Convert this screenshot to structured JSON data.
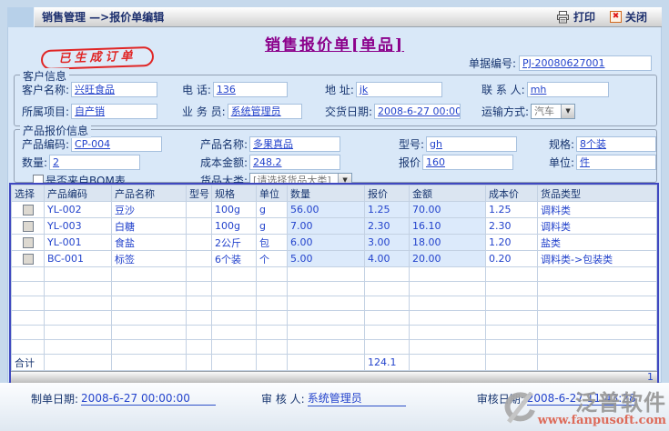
{
  "titlebar": {
    "breadcrumb": "销售管理 —>报价单编辑",
    "print_label": "打印",
    "close_label": "关闭"
  },
  "header": {
    "title": "销售报价单[单品]",
    "stamp": "已生成订单",
    "doc_no_label": "单据编号:",
    "doc_no": "PJ-20080627001"
  },
  "customer": {
    "legend": "客户信息",
    "rows": [
      [
        {
          "label": "客户名称:",
          "value": "兴旺食品"
        },
        {
          "label": "电 话:",
          "value": "136"
        },
        {
          "label": "地 址:",
          "value": "jk"
        },
        {
          "label": "联 系 人:",
          "value": "mh"
        }
      ],
      [
        {
          "label": "所属项目:",
          "value": "自产销"
        },
        {
          "label": "业 务 员:",
          "value": "系统管理员"
        },
        {
          "label": "交货日期:",
          "value": "2008-6-27 00:00"
        },
        {
          "label": "运输方式:",
          "value": "汽车"
        }
      ]
    ]
  },
  "product": {
    "legend": "产品报价信息",
    "rows": [
      [
        {
          "label": "产品编码:",
          "value": "CP-004"
        },
        {
          "label": "产品名称:",
          "value": "多果真品"
        },
        {
          "label": "型号:",
          "value": "gh"
        },
        {
          "label": "规格:",
          "value": "8个装"
        }
      ],
      [
        {
          "label": "数量:",
          "value": "2"
        },
        {
          "label": "成本金额:",
          "value": "248.2"
        },
        {
          "label": "报价",
          "value": "160"
        },
        {
          "label": "单位:",
          "value": "件"
        }
      ]
    ],
    "bom_label": "是否来自BOM表",
    "category_label": "货品大类:",
    "category_value": "[请选择货品大类]"
  },
  "table": {
    "columns": [
      "选择",
      "产品编码",
      "产品名称",
      "型号",
      "规格",
      "单位",
      "数量",
      "报价",
      "金额",
      "成本价",
      "货品类型"
    ],
    "rows": [
      {
        "code": "YL-002",
        "name": "豆沙",
        "model": "",
        "spec": "100g",
        "unit": "g",
        "qty": "56.00",
        "price": "1.25",
        "amount": "70.00",
        "cost": "1.25",
        "type": "调料类"
      },
      {
        "code": "YL-003",
        "name": "白糖",
        "model": "",
        "spec": "100g",
        "unit": "g",
        "qty": "7.00",
        "price": "2.30",
        "amount": "16.10",
        "cost": "2.30",
        "type": "调料类"
      },
      {
        "code": "YL-001",
        "name": "食盐",
        "model": "",
        "spec": "2公斤",
        "unit": "包",
        "qty": "6.00",
        "price": "3.00",
        "amount": "18.00",
        "cost": "1.20",
        "type": "盐类"
      },
      {
        "code": "BC-001",
        "name": "标签",
        "model": "",
        "spec": "6个装",
        "unit": "个",
        "qty": "5.00",
        "price": "4.00",
        "amount": "20.00",
        "cost": "0.20",
        "type": "调料类->包装类"
      }
    ],
    "total_label": "合计",
    "total_value": "124.1",
    "page_indicator": "1"
  },
  "footer": {
    "made_date_label": "制单日期:",
    "made_date": "2008-6-27 00:00:00",
    "auditor_label": "审 核 人:",
    "auditor": "系统管理员",
    "audit_date_label": "审核日期:",
    "audit_date": "2008-6-27 11:43:28"
  },
  "watermark": {
    "name": "泛普软件",
    "url": "www.fanpusoft.com"
  },
  "icons": {
    "dropdown_arrow": "▼",
    "close_x": "✖"
  },
  "colors": {
    "title_purple": "#8b008b",
    "stamp_red": "#e02525",
    "label_navy": "#17356f",
    "value_blue": "#2343cc",
    "table_border_blue": "#3f48c0",
    "watermark_gray": "#979797",
    "watermark_url_red": "#dd604c"
  }
}
